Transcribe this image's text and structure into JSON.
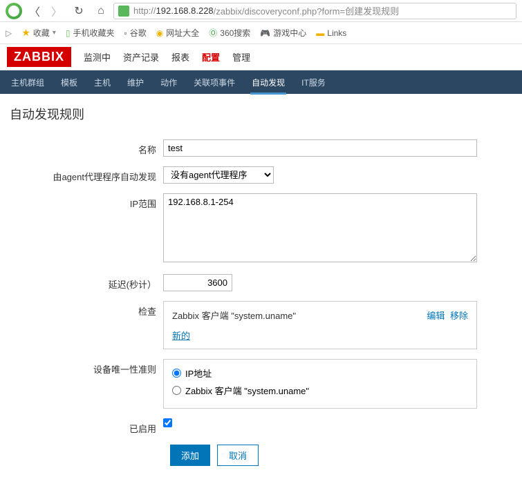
{
  "browser": {
    "url_prefix": "http://",
    "url_host": "192.168.8.228",
    "url_path": "/zabbix/discoveryconf.php?form=创建发现规则"
  },
  "bookmarks": {
    "favorites": "收藏",
    "mobile": "手机收藏夹",
    "google": "谷歌",
    "wangzhi": "网址大全",
    "sosuo": "360搜索",
    "youxi": "游戏中心",
    "links": "Links"
  },
  "zabbix": {
    "logo": "ZABBIX",
    "menu": {
      "monitoring": "监测中",
      "inventory": "资产记录",
      "reports": "报表",
      "config": "配置",
      "admin": "管理"
    },
    "subnav": {
      "hostgroups": "主机群组",
      "templates": "模板",
      "hosts": "主机",
      "maintenance": "维护",
      "actions": "动作",
      "correlation": "关联项事件",
      "discovery": "自动发现",
      "itservices": "IT服务"
    }
  },
  "page": {
    "title": "自动发现规则",
    "labels": {
      "name": "名称",
      "agent_proxy": "由agent代理程序自动发现",
      "ip_range": "IP范围",
      "delay": "延迟(秒计）",
      "checks": "检查",
      "uniqueness": "设备唯一性准则",
      "enabled": "已启用"
    },
    "form": {
      "name_value": "test",
      "agent_select_value": "没有agent代理程序",
      "ip_range_value": "192.168.8.1-254",
      "delay_value": "3600",
      "check_text": "Zabbix 客户端 \"system.uname\"",
      "check_edit": "编辑",
      "check_remove": "移除",
      "check_new": "新的",
      "radio_ip": "IP地址",
      "radio_agent": "Zabbix 客户端 \"system.uname\"",
      "enabled_checked": true
    },
    "buttons": {
      "add": "添加",
      "cancel": "取消"
    }
  }
}
